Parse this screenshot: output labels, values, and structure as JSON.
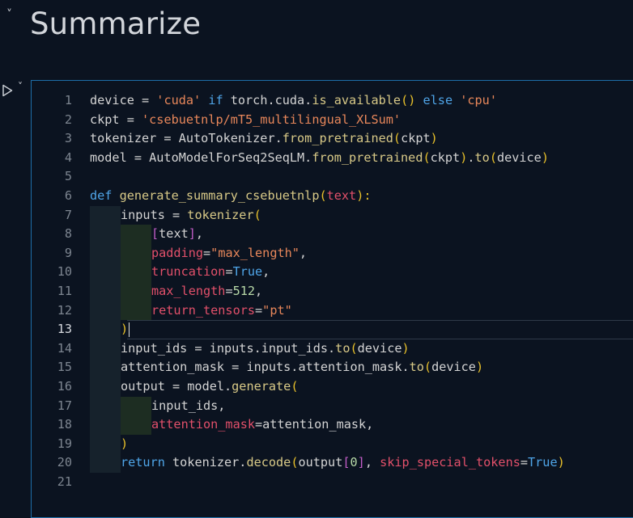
{
  "header": {
    "chevron": "˅",
    "title": "Summarize"
  },
  "cell": {
    "run_icon": "run-triangle-icon",
    "chevron": "˅",
    "current_line": 13
  },
  "colors": {
    "keyword": "#4fa5e8",
    "string": "#e8875a",
    "function": "#d8c987",
    "parameter": "#e2506a",
    "bracket": "#e9c12a",
    "cell_border": "#1e6ea8",
    "background": "#0b1320"
  },
  "lines": [
    {
      "n": "1",
      "indent": 0,
      "tokens": [
        [
          "device = ",
          "pl"
        ],
        [
          "'cuda'",
          "str"
        ],
        [
          " if ",
          "kw"
        ],
        [
          "torch.cuda.",
          "pl"
        ],
        [
          "is_available",
          "fn"
        ],
        [
          "()",
          "bk"
        ],
        [
          " else ",
          "kw"
        ],
        [
          "'cpu'",
          "str"
        ]
      ]
    },
    {
      "n": "2",
      "indent": 0,
      "tokens": [
        [
          "ckpt = ",
          "pl"
        ],
        [
          "'csebuetnlp/mT5_multilingual_XLSum'",
          "str"
        ]
      ]
    },
    {
      "n": "3",
      "indent": 0,
      "tokens": [
        [
          "tokenizer = AutoTokenizer.",
          "pl"
        ],
        [
          "from_pretrained",
          "fn"
        ],
        [
          "(",
          "bk"
        ],
        [
          "ckpt",
          "pl"
        ],
        [
          ")",
          "bk"
        ]
      ]
    },
    {
      "n": "4",
      "indent": 0,
      "tokens": [
        [
          "model = AutoModelForSeq2SeqLM.",
          "pl"
        ],
        [
          "from_pretrained",
          "fn"
        ],
        [
          "(",
          "bk"
        ],
        [
          "ckpt",
          "pl"
        ],
        [
          ")",
          "bk"
        ],
        [
          ".",
          "pl"
        ],
        [
          "to",
          "fn"
        ],
        [
          "(",
          "bk"
        ],
        [
          "device",
          "pl"
        ],
        [
          ")",
          "bk"
        ]
      ]
    },
    {
      "n": "5",
      "indent": 0,
      "tokens": []
    },
    {
      "n": "6",
      "indent": 0,
      "tokens": [
        [
          "def ",
          "kw"
        ],
        [
          "generate_summary_csebuetnlp",
          "fn"
        ],
        [
          "(",
          "bk"
        ],
        [
          "text",
          "prm"
        ],
        [
          "):",
          "bk"
        ]
      ]
    },
    {
      "n": "7",
      "indent": 1,
      "tokens": [
        [
          "inputs = ",
          "pl"
        ],
        [
          "tokenizer",
          "fn"
        ],
        [
          "(",
          "bk"
        ]
      ]
    },
    {
      "n": "8",
      "indent": 2,
      "tokens": [
        [
          "[",
          "bk2"
        ],
        [
          "text",
          "pl"
        ],
        [
          "]",
          "bk2"
        ],
        [
          ",",
          "pl"
        ]
      ]
    },
    {
      "n": "9",
      "indent": 2,
      "tokens": [
        [
          "padding",
          "prm"
        ],
        [
          "=",
          "pl"
        ],
        [
          "\"max_length\"",
          "str"
        ],
        [
          ",",
          "pl"
        ]
      ]
    },
    {
      "n": "10",
      "indent": 2,
      "tokens": [
        [
          "truncation",
          "prm"
        ],
        [
          "=",
          "pl"
        ],
        [
          "True",
          "kw"
        ],
        [
          ",",
          "pl"
        ]
      ]
    },
    {
      "n": "11",
      "indent": 2,
      "tokens": [
        [
          "max_length",
          "prm"
        ],
        [
          "=",
          "pl"
        ],
        [
          "512",
          "num"
        ],
        [
          ",",
          "pl"
        ]
      ]
    },
    {
      "n": "12",
      "indent": 2,
      "tokens": [
        [
          "return_tensors",
          "prm"
        ],
        [
          "=",
          "pl"
        ],
        [
          "\"pt\"",
          "str"
        ]
      ]
    },
    {
      "n": "13",
      "indent": 1,
      "tokens": [
        [
          ")",
          "bk"
        ]
      ],
      "cursor": true
    },
    {
      "n": "14",
      "indent": 1,
      "tokens": [
        [
          "input_ids = inputs.input_ids.",
          "pl"
        ],
        [
          "to",
          "fn"
        ],
        [
          "(",
          "bk"
        ],
        [
          "device",
          "pl"
        ],
        [
          ")",
          "bk"
        ]
      ]
    },
    {
      "n": "15",
      "indent": 1,
      "tokens": [
        [
          "attention_mask = inputs.attention_mask.",
          "pl"
        ],
        [
          "to",
          "fn"
        ],
        [
          "(",
          "bk"
        ],
        [
          "device",
          "pl"
        ],
        [
          ")",
          "bk"
        ]
      ]
    },
    {
      "n": "16",
      "indent": 1,
      "tokens": [
        [
          "output = model.",
          "pl"
        ],
        [
          "generate",
          "fn"
        ],
        [
          "(",
          "bk"
        ]
      ]
    },
    {
      "n": "17",
      "indent": 2,
      "tokens": [
        [
          "input_ids",
          "pl"
        ],
        [
          ",",
          "pl"
        ]
      ]
    },
    {
      "n": "18",
      "indent": 2,
      "tokens": [
        [
          "attention_mask",
          "prm"
        ],
        [
          "=attention_mask,",
          "pl"
        ]
      ]
    },
    {
      "n": "19",
      "indent": 1,
      "tokens": [
        [
          ")",
          "bk"
        ]
      ]
    },
    {
      "n": "20",
      "indent": 1,
      "tokens": [
        [
          "return ",
          "kw"
        ],
        [
          "tokenizer.",
          "pl"
        ],
        [
          "decode",
          "fn"
        ],
        [
          "(",
          "bk"
        ],
        [
          "output",
          "pl"
        ],
        [
          "[",
          "bk2"
        ],
        [
          "0",
          "num"
        ],
        [
          "]",
          "bk2"
        ],
        [
          ", ",
          "pl"
        ],
        [
          "skip_special_tokens",
          "prm"
        ],
        [
          "=",
          "pl"
        ],
        [
          "True",
          "kw"
        ],
        [
          ")",
          "bk"
        ]
      ]
    },
    {
      "n": "21",
      "indent": 0,
      "tokens": []
    }
  ]
}
